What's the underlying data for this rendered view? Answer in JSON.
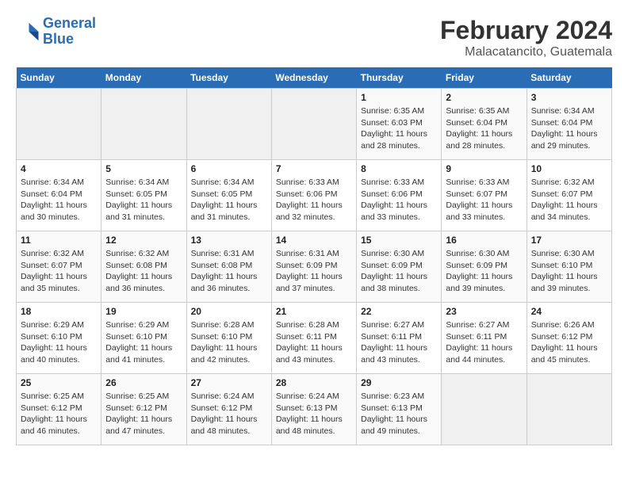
{
  "logo": {
    "line1": "General",
    "line2": "Blue"
  },
  "title": "February 2024",
  "subtitle": "Malacatancito, Guatemala",
  "days_of_week": [
    "Sunday",
    "Monday",
    "Tuesday",
    "Wednesday",
    "Thursday",
    "Friday",
    "Saturday"
  ],
  "weeks": [
    [
      {
        "num": "",
        "info": ""
      },
      {
        "num": "",
        "info": ""
      },
      {
        "num": "",
        "info": ""
      },
      {
        "num": "",
        "info": ""
      },
      {
        "num": "1",
        "info": "Sunrise: 6:35 AM\nSunset: 6:03 PM\nDaylight: 11 hours and 28 minutes."
      },
      {
        "num": "2",
        "info": "Sunrise: 6:35 AM\nSunset: 6:04 PM\nDaylight: 11 hours and 28 minutes."
      },
      {
        "num": "3",
        "info": "Sunrise: 6:34 AM\nSunset: 6:04 PM\nDaylight: 11 hours and 29 minutes."
      }
    ],
    [
      {
        "num": "4",
        "info": "Sunrise: 6:34 AM\nSunset: 6:04 PM\nDaylight: 11 hours and 30 minutes."
      },
      {
        "num": "5",
        "info": "Sunrise: 6:34 AM\nSunset: 6:05 PM\nDaylight: 11 hours and 31 minutes."
      },
      {
        "num": "6",
        "info": "Sunrise: 6:34 AM\nSunset: 6:05 PM\nDaylight: 11 hours and 31 minutes."
      },
      {
        "num": "7",
        "info": "Sunrise: 6:33 AM\nSunset: 6:06 PM\nDaylight: 11 hours and 32 minutes."
      },
      {
        "num": "8",
        "info": "Sunrise: 6:33 AM\nSunset: 6:06 PM\nDaylight: 11 hours and 33 minutes."
      },
      {
        "num": "9",
        "info": "Sunrise: 6:33 AM\nSunset: 6:07 PM\nDaylight: 11 hours and 33 minutes."
      },
      {
        "num": "10",
        "info": "Sunrise: 6:32 AM\nSunset: 6:07 PM\nDaylight: 11 hours and 34 minutes."
      }
    ],
    [
      {
        "num": "11",
        "info": "Sunrise: 6:32 AM\nSunset: 6:07 PM\nDaylight: 11 hours and 35 minutes."
      },
      {
        "num": "12",
        "info": "Sunrise: 6:32 AM\nSunset: 6:08 PM\nDaylight: 11 hours and 36 minutes."
      },
      {
        "num": "13",
        "info": "Sunrise: 6:31 AM\nSunset: 6:08 PM\nDaylight: 11 hours and 36 minutes."
      },
      {
        "num": "14",
        "info": "Sunrise: 6:31 AM\nSunset: 6:09 PM\nDaylight: 11 hours and 37 minutes."
      },
      {
        "num": "15",
        "info": "Sunrise: 6:30 AM\nSunset: 6:09 PM\nDaylight: 11 hours and 38 minutes."
      },
      {
        "num": "16",
        "info": "Sunrise: 6:30 AM\nSunset: 6:09 PM\nDaylight: 11 hours and 39 minutes."
      },
      {
        "num": "17",
        "info": "Sunrise: 6:30 AM\nSunset: 6:10 PM\nDaylight: 11 hours and 39 minutes."
      }
    ],
    [
      {
        "num": "18",
        "info": "Sunrise: 6:29 AM\nSunset: 6:10 PM\nDaylight: 11 hours and 40 minutes."
      },
      {
        "num": "19",
        "info": "Sunrise: 6:29 AM\nSunset: 6:10 PM\nDaylight: 11 hours and 41 minutes."
      },
      {
        "num": "20",
        "info": "Sunrise: 6:28 AM\nSunset: 6:10 PM\nDaylight: 11 hours and 42 minutes."
      },
      {
        "num": "21",
        "info": "Sunrise: 6:28 AM\nSunset: 6:11 PM\nDaylight: 11 hours and 43 minutes."
      },
      {
        "num": "22",
        "info": "Sunrise: 6:27 AM\nSunset: 6:11 PM\nDaylight: 11 hours and 43 minutes."
      },
      {
        "num": "23",
        "info": "Sunrise: 6:27 AM\nSunset: 6:11 PM\nDaylight: 11 hours and 44 minutes."
      },
      {
        "num": "24",
        "info": "Sunrise: 6:26 AM\nSunset: 6:12 PM\nDaylight: 11 hours and 45 minutes."
      }
    ],
    [
      {
        "num": "25",
        "info": "Sunrise: 6:25 AM\nSunset: 6:12 PM\nDaylight: 11 hours and 46 minutes."
      },
      {
        "num": "26",
        "info": "Sunrise: 6:25 AM\nSunset: 6:12 PM\nDaylight: 11 hours and 47 minutes."
      },
      {
        "num": "27",
        "info": "Sunrise: 6:24 AM\nSunset: 6:12 PM\nDaylight: 11 hours and 48 minutes."
      },
      {
        "num": "28",
        "info": "Sunrise: 6:24 AM\nSunset: 6:13 PM\nDaylight: 11 hours and 48 minutes."
      },
      {
        "num": "29",
        "info": "Sunrise: 6:23 AM\nSunset: 6:13 PM\nDaylight: 11 hours and 49 minutes."
      },
      {
        "num": "",
        "info": ""
      },
      {
        "num": "",
        "info": ""
      }
    ]
  ]
}
